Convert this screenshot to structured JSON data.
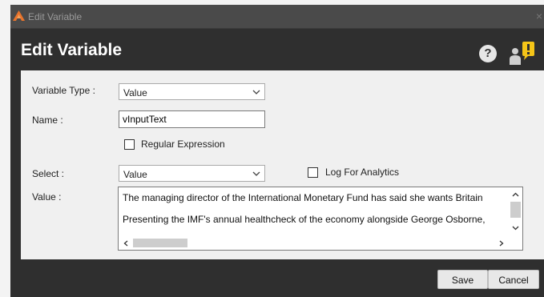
{
  "window": {
    "title": "Edit Variable",
    "close_glyph": "×"
  },
  "header": {
    "title": "Edit Variable",
    "help_glyph": "?"
  },
  "icons": {
    "app": "app-logo-icon",
    "help": "help-icon",
    "user_alert": "user-alert-icon"
  },
  "form": {
    "variable_type": {
      "label": "Variable Type :",
      "value": "Value"
    },
    "name": {
      "label": "Name :",
      "value": "vInputText"
    },
    "regex": {
      "label": "Regular Expression",
      "checked": false
    },
    "select": {
      "label": "Select :",
      "value": "Value"
    },
    "log_analytics": {
      "label": "Log For Analytics",
      "checked": false
    },
    "value": {
      "label": "Value :",
      "lines": [
        "The managing director of the International Monetary Fund has said she wants Britain",
        "Presenting the IMF's annual healthcheck of the economy alongside George Osborne,"
      ]
    }
  },
  "buttons": {
    "save": "Save",
    "cancel": "Cancel"
  },
  "colors": {
    "title_bar": "#4a4a4a",
    "header_bg": "#2f2f2f",
    "panel_bg": "#f0f0f0",
    "alert_yellow": "#f5c518"
  }
}
